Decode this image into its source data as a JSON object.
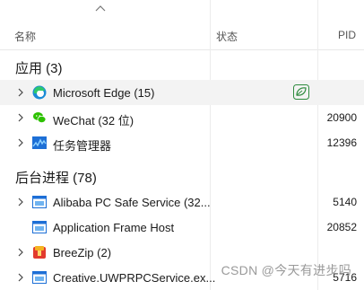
{
  "columns": {
    "name": "名称",
    "status": "状态",
    "pid": "PID"
  },
  "groups": {
    "apps": "应用 (3)",
    "background": "后台进程 (78)"
  },
  "apps": [
    {
      "name": "Microsoft Edge (15)",
      "pid": "",
      "icon": "edge-icon",
      "status_icon": "efficiency-leaf-icon"
    },
    {
      "name": "WeChat (32 位)",
      "pid": "20900",
      "icon": "wechat-icon"
    },
    {
      "name": "任务管理器",
      "pid": "12396",
      "icon": "task-manager-icon"
    }
  ],
  "background": [
    {
      "name": "Alibaba PC Safe Service (32...",
      "pid": "5140",
      "icon": "app-window-icon"
    },
    {
      "name": "Application Frame Host",
      "pid": "20852",
      "icon": "app-window-icon"
    },
    {
      "name": "BreeZip (2)",
      "pid": "",
      "icon": "breezip-icon"
    },
    {
      "name": "Creative.UWPRPCService.ex...",
      "pid": "5716",
      "icon": "app-window-icon"
    }
  ],
  "watermark": "CSDN @今天有进步吗",
  "colors": {
    "accent": "#0f6cbd",
    "leaf": "#2e8b3e",
    "row_highlight": "#f3f3f3"
  }
}
